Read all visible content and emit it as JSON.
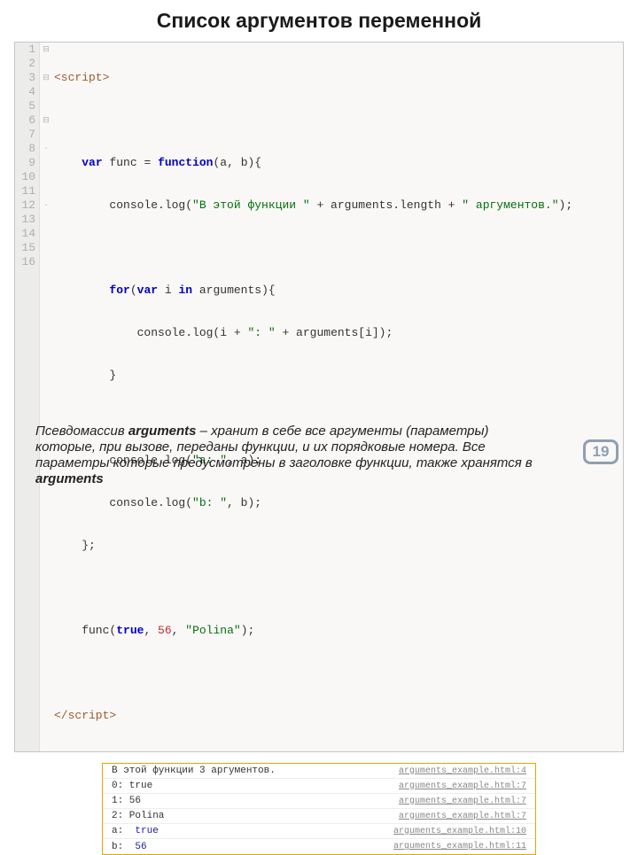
{
  "title": "Список аргументов переменной",
  "code": {
    "lines": [
      1,
      2,
      3,
      4,
      5,
      6,
      7,
      8,
      9,
      10,
      11,
      12,
      13,
      14,
      15,
      16
    ],
    "fold": [
      "⊟",
      "",
      "⊟",
      "",
      "",
      "⊟",
      "",
      "·",
      "",
      "",
      "",
      "·",
      "",
      "",
      "",
      ""
    ],
    "l1a": "<script>",
    "l3_var": "var",
    "l3_func": "func",
    "l3_eq": " = ",
    "l3_fn": "function",
    "l3_rest": "(a, b){",
    "l4_a": "        console.log(",
    "l4_s1": "\"В этой функции \"",
    "l4_b": " + arguments.length + ",
    "l4_s2": "\" аргументов.\"",
    "l4_c": ");",
    "l6_a": "        ",
    "l6_for": "for",
    "l6_b": "(",
    "l6_var": "var",
    "l6_c": " i ",
    "l6_in": "in",
    "l6_d": " arguments){",
    "l7_a": "            console.log(i + ",
    "l7_s1": "\": \"",
    "l7_b": " + arguments[i]);",
    "l8": "        }",
    "l10_a": "        console.log(",
    "l10_s": "\"a: \"",
    "l10_b": ", a);",
    "l11_a": "        console.log(",
    "l11_s": "\"b: \"",
    "l11_b": ", b);",
    "l12": "    };",
    "l14_a": "    func(",
    "l14_t": "true",
    "l14_b": ", ",
    "l14_n": "56",
    "l14_c": ", ",
    "l14_s": "\"Polina\"",
    "l14_d": ");",
    "l16": "</script>"
  },
  "console": [
    {
      "msg_pre": "В этой функции 3 аргументов.",
      "msg_val": "",
      "src": "arguments_example.html:4"
    },
    {
      "msg_pre": "0: true",
      "msg_val": "",
      "src": "arguments_example.html:7"
    },
    {
      "msg_pre": "1: 56",
      "msg_val": "",
      "src": "arguments_example.html:7"
    },
    {
      "msg_pre": "2: Polina",
      "msg_val": "",
      "src": "arguments_example.html:7"
    },
    {
      "msg_pre": "a:  ",
      "msg_val": "true",
      "src": "arguments_example.html:10"
    },
    {
      "msg_pre": "b:  ",
      "msg_val": "56",
      "src": "arguments_example.html:11"
    }
  ],
  "desc": {
    "p1a": "Псевдомассив ",
    "kw": "arguments",
    "p1b": " – хранит в себе все аргументы (параметры)  которые, при вызове, переданы функции, и их порядковые номера. Все параметры которые предусмотрены в заголовке функции, также хранятся в ",
    "p2": "arguments"
  },
  "page": "19"
}
